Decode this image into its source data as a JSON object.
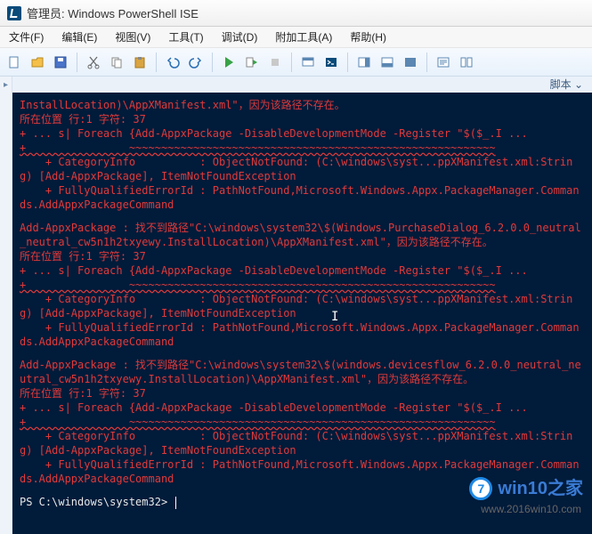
{
  "title": "管理员: Windows PowerShell ISE",
  "menu": {
    "file": "文件(F)",
    "edit": "编辑(E)",
    "view": "视图(V)",
    "tools": "工具(T)",
    "debug": "调试(D)",
    "addons": "附加工具(A)",
    "help": "帮助(H)"
  },
  "toolbar_icons": {
    "new": "new-file-icon",
    "open": "open-file-icon",
    "save": "save-icon",
    "cut": "cut-icon",
    "copy": "copy-icon",
    "paste": "paste-icon",
    "undo": "undo-icon",
    "redo": "redo-icon",
    "run": "run-icon",
    "run_selection": "run-selection-icon",
    "stop": "stop-icon",
    "layout1": "layout-right-icon",
    "layout2": "layout-bottom-icon",
    "layout3": "layout-full-icon",
    "show_script": "show-script-icon",
    "show_command": "show-command-icon"
  },
  "script_label": "脚本",
  "collapse_glyph": "▸",
  "console": {
    "block1": {
      "l1": "InstallLocation)\\AppXManifest.xml\"，因为该路径不存在。",
      "l2": "所在位置 行:1 字符: 37",
      "l3": "+ ... s| Foreach {Add-AppxPackage -DisableDevelopmentMode -Register \"$($_.I ...",
      "l4": "+                ~~~~~~~~~~~~~~~~~~~~~~~~~~~~~~~~~~~~~~~~~~~~~~~~~~~~~~~~~",
      "l5": "    + CategoryInfo          : ObjectNotFound: (C:\\windows\\syst...ppXManifest.xml:String) [Add-AppxPackage], ItemNotFoundException",
      "l6": "    + FullyQualifiedErrorId : PathNotFound,Microsoft.Windows.Appx.PackageManager.Commands.AddAppxPackageCommand"
    },
    "block2": {
      "l1": "Add-AppxPackage : 找不到路径\"C:\\windows\\system32\\$(Windows.PurchaseDialog_6.2.0.0_neutral_neutral_cw5n1h2txyewy.InstallLocation)\\AppXManifest.xml\"，因为该路径不存在。",
      "l2": "所在位置 行:1 字符: 37",
      "l3": "+ ... s| Foreach {Add-AppxPackage -DisableDevelopmentMode -Register \"$($_.I ...",
      "l4": "+                ~~~~~~~~~~~~~~~~~~~~~~~~~~~~~~~~~~~~~~~~~~~~~~~~~~~~~~~~~",
      "l5": "    + CategoryInfo          : ObjectNotFound: (C:\\windows\\syst...ppXManifest.xml:String) [Add-AppxPackage], ItemNotFoundException",
      "l6": "    + FullyQualifiedErrorId : PathNotFound,Microsoft.Windows.Appx.PackageManager.Commands.AddAppxPackageCommand"
    },
    "block3": {
      "l1": "Add-AppxPackage : 找不到路径\"C:\\windows\\system32\\$(windows.devicesflow_6.2.0.0_neutral_neutral_cw5n1h2txyewy.InstallLocation)\\AppXManifest.xml\"，因为该路径不存在。",
      "l2": "所在位置 行:1 字符: 37",
      "l3": "+ ... s| Foreach {Add-AppxPackage -DisableDevelopmentMode -Register \"$($_.I ...",
      "l4": "+                ~~~~~~~~~~~~~~~~~~~~~~~~~~~~~~~~~~~~~~~~~~~~~~~~~~~~~~~~~",
      "l5": "    + CategoryInfo          : ObjectNotFound: (C:\\windows\\syst...ppXManifest.xml:String) [Add-AppxPackage], ItemNotFoundException",
      "l6": "    + FullyQualifiedErrorId : PathNotFound,Microsoft.Windows.Appx.PackageManager.Commands.AddAppxPackageCommand"
    },
    "prompt": "PS C:\\windows\\system32> "
  },
  "watermark": {
    "badge_char": "7",
    "text": "win10之家",
    "url": "www.2016win10.com"
  }
}
